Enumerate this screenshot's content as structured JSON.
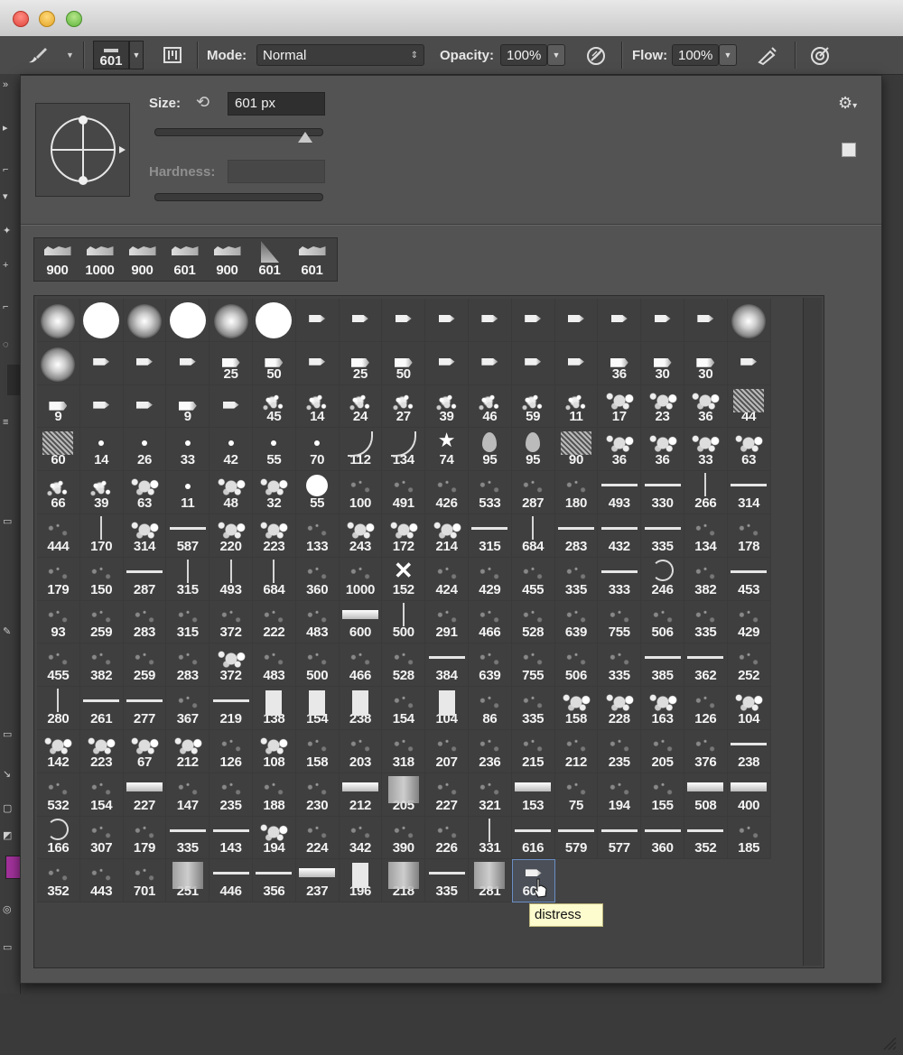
{
  "options_bar": {
    "brush_size_value": "601",
    "mode_label": "Mode:",
    "mode_value": "Normal",
    "opacity_label": "Opacity:",
    "opacity_value": "100%",
    "flow_label": "Flow:",
    "flow_value": "100%"
  },
  "brush_panel": {
    "size_label": "Size:",
    "size_value": "601 px",
    "hardness_label": "Hardness:",
    "size_slider_fraction": 0.9
  },
  "recent_brushes": [
    "900",
    "1000",
    "900",
    "601",
    "900",
    "601",
    "601"
  ],
  "brushes": [
    {
      "label": "",
      "thumb": "soft"
    },
    {
      "label": "",
      "thumb": "hard"
    },
    {
      "label": "",
      "thumb": "soft"
    },
    {
      "label": "",
      "thumb": "hard"
    },
    {
      "label": "",
      "thumb": "soft"
    },
    {
      "label": "",
      "thumb": "hard"
    },
    {
      "label": "",
      "thumb": "tip"
    },
    {
      "label": "",
      "thumb": "tip"
    },
    {
      "label": "",
      "thumb": "tip"
    },
    {
      "label": "",
      "thumb": "tip"
    },
    {
      "label": "",
      "thumb": "tip"
    },
    {
      "label": "",
      "thumb": "tip"
    },
    {
      "label": "",
      "thumb": "tip"
    },
    {
      "label": "",
      "thumb": "tip"
    },
    {
      "label": "",
      "thumb": "tip"
    },
    {
      "label": "",
      "thumb": "tip"
    },
    {
      "label": "",
      "thumb": "soft"
    },
    {
      "label": "",
      "thumb": "soft"
    },
    {
      "label": "",
      "thumb": "tip"
    },
    {
      "label": "",
      "thumb": "tip"
    },
    {
      "label": "",
      "thumb": "tip"
    },
    {
      "label": "25",
      "thumb": "tip2"
    },
    {
      "label": "50",
      "thumb": "tip2"
    },
    {
      "label": "",
      "thumb": "tip"
    },
    {
      "label": "25",
      "thumb": "tip2"
    },
    {
      "label": "50",
      "thumb": "tip2"
    },
    {
      "label": "",
      "thumb": "tip"
    },
    {
      "label": "",
      "thumb": "tip"
    },
    {
      "label": "",
      "thumb": "tip"
    },
    {
      "label": "",
      "thumb": "tip"
    },
    {
      "label": "36",
      "thumb": "tip2"
    },
    {
      "label": "30",
      "thumb": "tip2"
    },
    {
      "label": "30",
      "thumb": "tip2"
    },
    {
      "label": "",
      "thumb": "tip"
    },
    {
      "label": "9",
      "thumb": "tip2"
    },
    {
      "label": "",
      "thumb": "tip"
    },
    {
      "label": "",
      "thumb": "tip"
    },
    {
      "label": "9",
      "thumb": "tip2"
    },
    {
      "label": "",
      "thumb": "tip"
    },
    {
      "label": "45",
      "thumb": "spray"
    },
    {
      "label": "14",
      "thumb": "spray"
    },
    {
      "label": "24",
      "thumb": "spray"
    },
    {
      "label": "27",
      "thumb": "spray"
    },
    {
      "label": "39",
      "thumb": "spray"
    },
    {
      "label": "46",
      "thumb": "spray"
    },
    {
      "label": "59",
      "thumb": "spray"
    },
    {
      "label": "11",
      "thumb": "spray"
    },
    {
      "label": "17",
      "thumb": "grunge"
    },
    {
      "label": "23",
      "thumb": "grunge"
    },
    {
      "label": "36",
      "thumb": "grunge"
    },
    {
      "label": "44",
      "thumb": "texture"
    },
    {
      "label": "60",
      "thumb": "texture"
    },
    {
      "label": "14",
      "thumb": "dot"
    },
    {
      "label": "26",
      "thumb": "dot"
    },
    {
      "label": "33",
      "thumb": "dot"
    },
    {
      "label": "42",
      "thumb": "dot"
    },
    {
      "label": "55",
      "thumb": "dot"
    },
    {
      "label": "70",
      "thumb": "dot"
    },
    {
      "label": "112",
      "thumb": "grass"
    },
    {
      "label": "134",
      "thumb": "grass"
    },
    {
      "label": "74",
      "thumb": "star"
    },
    {
      "label": "95",
      "thumb": "leaf"
    },
    {
      "label": "95",
      "thumb": "leaf"
    },
    {
      "label": "90",
      "thumb": "texture"
    },
    {
      "label": "36",
      "thumb": "grunge"
    },
    {
      "label": "36",
      "thumb": "grunge"
    },
    {
      "label": "33",
      "thumb": "grunge"
    },
    {
      "label": "63",
      "thumb": "grunge"
    },
    {
      "label": "66",
      "thumb": "spray"
    },
    {
      "label": "39",
      "thumb": "spray"
    },
    {
      "label": "63",
      "thumb": "grunge"
    },
    {
      "label": "11",
      "thumb": "dot"
    },
    {
      "label": "48",
      "thumb": "grunge"
    },
    {
      "label": "32",
      "thumb": "grunge"
    },
    {
      "label": "55",
      "thumb": "hard-sm"
    },
    {
      "label": "100",
      "thumb": "faint"
    },
    {
      "label": "491",
      "thumb": "faint"
    },
    {
      "label": "426",
      "thumb": "faint"
    },
    {
      "label": "533",
      "thumb": "faint"
    },
    {
      "label": "287",
      "thumb": "faint"
    },
    {
      "label": "180",
      "thumb": "faint"
    },
    {
      "label": "493",
      "thumb": "line"
    },
    {
      "label": "330",
      "thumb": "line"
    },
    {
      "label": "266",
      "thumb": "vline"
    },
    {
      "label": "314",
      "thumb": "line"
    },
    {
      "label": "444",
      "thumb": "faint"
    },
    {
      "label": "170",
      "thumb": "vline"
    },
    {
      "label": "314",
      "thumb": "grunge"
    },
    {
      "label": "587",
      "thumb": "line"
    },
    {
      "label": "220",
      "thumb": "grunge"
    },
    {
      "label": "223",
      "thumb": "grunge"
    },
    {
      "label": "133",
      "thumb": "faint"
    },
    {
      "label": "243",
      "thumb": "grunge"
    },
    {
      "label": "172",
      "thumb": "grunge"
    },
    {
      "label": "214",
      "thumb": "grunge"
    },
    {
      "label": "315",
      "thumb": "line"
    },
    {
      "label": "684",
      "thumb": "vline"
    },
    {
      "label": "283",
      "thumb": "line"
    },
    {
      "label": "432",
      "thumb": "line"
    },
    {
      "label": "335",
      "thumb": "line"
    },
    {
      "label": "134",
      "thumb": "faint"
    },
    {
      "label": "178",
      "thumb": "faint"
    },
    {
      "label": "179",
      "thumb": "faint"
    },
    {
      "label": "150",
      "thumb": "faint"
    },
    {
      "label": "287",
      "thumb": "line"
    },
    {
      "label": "315",
      "thumb": "vline"
    },
    {
      "label": "493",
      "thumb": "vline"
    },
    {
      "label": "684",
      "thumb": "vline"
    },
    {
      "label": "360",
      "thumb": "faint"
    },
    {
      "label": "1000",
      "thumb": "faint"
    },
    {
      "label": "152",
      "thumb": "x"
    },
    {
      "label": "424",
      "thumb": "faint"
    },
    {
      "label": "429",
      "thumb": "faint"
    },
    {
      "label": "455",
      "thumb": "faint"
    },
    {
      "label": "335",
      "thumb": "faint"
    },
    {
      "label": "333",
      "thumb": "line"
    },
    {
      "label": "246",
      "thumb": "swirl"
    },
    {
      "label": "382",
      "thumb": "faint"
    },
    {
      "label": "453",
      "thumb": "line"
    },
    {
      "label": "93",
      "thumb": "faint"
    },
    {
      "label": "259",
      "thumb": "faint"
    },
    {
      "label": "283",
      "thumb": "faint"
    },
    {
      "label": "315",
      "thumb": "faint"
    },
    {
      "label": "372",
      "thumb": "faint"
    },
    {
      "label": "222",
      "thumb": "faint"
    },
    {
      "label": "483",
      "thumb": "faint"
    },
    {
      "label": "600",
      "thumb": "bar"
    },
    {
      "label": "500",
      "thumb": "vline"
    },
    {
      "label": "291",
      "thumb": "faint"
    },
    {
      "label": "466",
      "thumb": "faint"
    },
    {
      "label": "528",
      "thumb": "faint"
    },
    {
      "label": "639",
      "thumb": "faint"
    },
    {
      "label": "755",
      "thumb": "faint"
    },
    {
      "label": "506",
      "thumb": "faint"
    },
    {
      "label": "335",
      "thumb": "faint"
    },
    {
      "label": "429",
      "thumb": "faint"
    },
    {
      "label": "455",
      "thumb": "faint"
    },
    {
      "label": "382",
      "thumb": "faint"
    },
    {
      "label": "259",
      "thumb": "faint"
    },
    {
      "label": "283",
      "thumb": "faint"
    },
    {
      "label": "372",
      "thumb": "grunge"
    },
    {
      "label": "483",
      "thumb": "faint"
    },
    {
      "label": "500",
      "thumb": "faint"
    },
    {
      "label": "466",
      "thumb": "faint"
    },
    {
      "label": "528",
      "thumb": "faint"
    },
    {
      "label": "384",
      "thumb": "line"
    },
    {
      "label": "639",
      "thumb": "faint"
    },
    {
      "label": "755",
      "thumb": "faint"
    },
    {
      "label": "506",
      "thumb": "faint"
    },
    {
      "label": "335",
      "thumb": "faint"
    },
    {
      "label": "385",
      "thumb": "line"
    },
    {
      "label": "362",
      "thumb": "line"
    },
    {
      "label": "252",
      "thumb": "faint"
    },
    {
      "label": "280",
      "thumb": "vline"
    },
    {
      "label": "261",
      "thumb": "line"
    },
    {
      "label": "277",
      "thumb": "line"
    },
    {
      "label": "367",
      "thumb": "faint"
    },
    {
      "label": "219",
      "thumb": "line"
    },
    {
      "label": "138",
      "thumb": "block"
    },
    {
      "label": "154",
      "thumb": "block"
    },
    {
      "label": "238",
      "thumb": "block"
    },
    {
      "label": "154",
      "thumb": "faint"
    },
    {
      "label": "104",
      "thumb": "block"
    },
    {
      "label": "86",
      "thumb": "faint"
    },
    {
      "label": "335",
      "thumb": "faint"
    },
    {
      "label": "158",
      "thumb": "grunge"
    },
    {
      "label": "228",
      "thumb": "grunge"
    },
    {
      "label": "163",
      "thumb": "grunge"
    },
    {
      "label": "126",
      "thumb": "faint"
    },
    {
      "label": "104",
      "thumb": "grunge"
    },
    {
      "label": "142",
      "thumb": "grunge"
    },
    {
      "label": "223",
      "thumb": "grunge"
    },
    {
      "label": "67",
      "thumb": "grunge"
    },
    {
      "label": "212",
      "thumb": "grunge"
    },
    {
      "label": "126",
      "thumb": "faint"
    },
    {
      "label": "108",
      "thumb": "grunge"
    },
    {
      "label": "158",
      "thumb": "faint"
    },
    {
      "label": "203",
      "thumb": "faint"
    },
    {
      "label": "318",
      "thumb": "faint"
    },
    {
      "label": "207",
      "thumb": "faint"
    },
    {
      "label": "236",
      "thumb": "faint"
    },
    {
      "label": "215",
      "thumb": "faint"
    },
    {
      "label": "212",
      "thumb": "faint"
    },
    {
      "label": "235",
      "thumb": "faint"
    },
    {
      "label": "205",
      "thumb": "faint"
    },
    {
      "label": "376",
      "thumb": "faint"
    },
    {
      "label": "238",
      "thumb": "line"
    },
    {
      "label": "532",
      "thumb": "faint"
    },
    {
      "label": "154",
      "thumb": "faint"
    },
    {
      "label": "227",
      "thumb": "bar"
    },
    {
      "label": "147",
      "thumb": "faint"
    },
    {
      "label": "235",
      "thumb": "faint"
    },
    {
      "label": "188",
      "thumb": "faint"
    },
    {
      "label": "230",
      "thumb": "faint"
    },
    {
      "label": "212",
      "thumb": "bar"
    },
    {
      "label": "205",
      "thumb": "tall"
    },
    {
      "label": "227",
      "thumb": "faint"
    },
    {
      "label": "321",
      "thumb": "faint"
    },
    {
      "label": "153",
      "thumb": "bar"
    },
    {
      "label": "75",
      "thumb": "faint"
    },
    {
      "label": "194",
      "thumb": "faint"
    },
    {
      "label": "155",
      "thumb": "faint"
    },
    {
      "label": "508",
      "thumb": "bar"
    },
    {
      "label": "400",
      "thumb": "bar"
    },
    {
      "label": "166",
      "thumb": "swirl"
    },
    {
      "label": "307",
      "thumb": "faint"
    },
    {
      "label": "179",
      "thumb": "faint"
    },
    {
      "label": "335",
      "thumb": "line"
    },
    {
      "label": "143",
      "thumb": "line"
    },
    {
      "label": "194",
      "thumb": "grunge"
    },
    {
      "label": "224",
      "thumb": "faint"
    },
    {
      "label": "342",
      "thumb": "faint"
    },
    {
      "label": "390",
      "thumb": "faint"
    },
    {
      "label": "226",
      "thumb": "faint"
    },
    {
      "label": "331",
      "thumb": "vline"
    },
    {
      "label": "616",
      "thumb": "line"
    },
    {
      "label": "579",
      "thumb": "line"
    },
    {
      "label": "577",
      "thumb": "line"
    },
    {
      "label": "360",
      "thumb": "line"
    },
    {
      "label": "352",
      "thumb": "line"
    },
    {
      "label": "185",
      "thumb": "faint"
    },
    {
      "label": "352",
      "thumb": "faint"
    },
    {
      "label": "443",
      "thumb": "faint"
    },
    {
      "label": "701",
      "thumb": "faint"
    },
    {
      "label": "251",
      "thumb": "tall"
    },
    {
      "label": "446",
      "thumb": "line"
    },
    {
      "label": "356",
      "thumb": "line"
    },
    {
      "label": "237",
      "thumb": "bar"
    },
    {
      "label": "196",
      "thumb": "block"
    },
    {
      "label": "218",
      "thumb": "tall"
    },
    {
      "label": "335",
      "thumb": "line"
    },
    {
      "label": "281",
      "thumb": "tall"
    },
    {
      "label": "600",
      "thumb": "tip",
      "selected": true
    }
  ],
  "tooltip": "distress",
  "icons": {
    "brush_tool": "brush-icon",
    "brush_panel_toggle": "brush-panel-icon",
    "opacity_pressure": "pressure-opacity-icon",
    "airbrush": "airbrush-icon",
    "size_pressure": "pressure-size-icon",
    "reset": "reset-icon",
    "gear": "gear-icon",
    "new_preset": "new-preset-icon"
  }
}
